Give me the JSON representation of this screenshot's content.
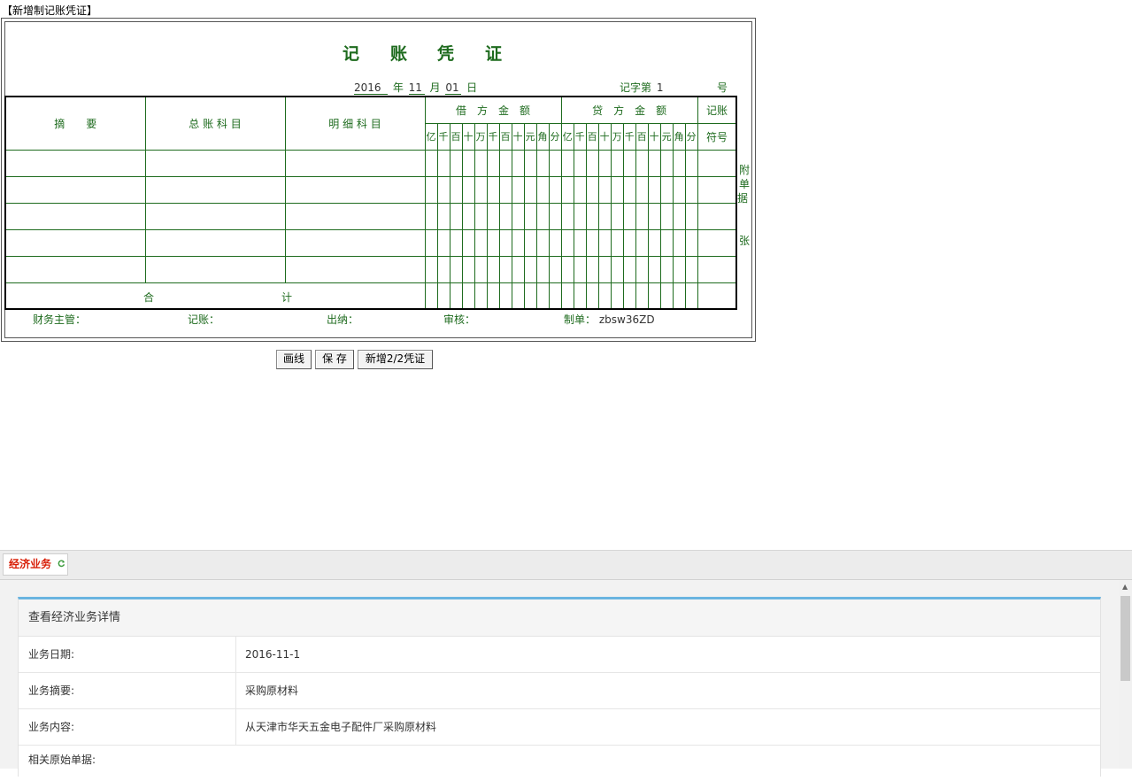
{
  "page_heading": "【新增制记账凭证】",
  "voucher": {
    "title_chars": [
      "记",
      "账",
      "凭",
      "证"
    ],
    "date": {
      "year": "2016",
      "year_unit": "年",
      "month": "11",
      "month_unit": "月",
      "day": "01",
      "day_unit": "日"
    },
    "number": {
      "prefix": "记字第",
      "value": "1",
      "suffix": "号"
    },
    "headers": {
      "summary": "摘　　要",
      "general_account": "总 账 科 目",
      "detail_account": "明 细 科 目",
      "debit": "借　方　金　额",
      "credit": "贷　方　金　额",
      "mark_top": "记账",
      "mark_bottom": "符号",
      "digits": [
        "亿",
        "千",
        "百",
        "十",
        "万",
        "千",
        "百",
        "十",
        "元",
        "角",
        "分"
      ]
    },
    "total_label_left": "合",
    "total_label_right": "计",
    "attachment": {
      "line1": "附",
      "line2": "单",
      "line3": "据",
      "unit": "张"
    },
    "signatures": {
      "supervisor_label": "财务主管：",
      "bookkeeper_label": "记账：",
      "cashier_label": "出纳：",
      "auditor_label": "审核：",
      "preparer_label": "制单：",
      "preparer_value": "zbsw36ZD"
    }
  },
  "buttons": {
    "draw_line": "画线",
    "save": "保 存",
    "new_voucher": "新增2/2凭证"
  },
  "bottom_panel": {
    "tab_label": "经济业务",
    "card_title": "查看经济业务详情",
    "rows": [
      {
        "label": "业务日期:",
        "value": "2016-11-1"
      },
      {
        "label": "业务摘要:",
        "value": "采购原材料"
      },
      {
        "label": "业务内容:",
        "value": "从天津市华天五金电子配件厂采购原材料"
      }
    ],
    "cut_row_label": "相关原始单据:"
  },
  "colors": {
    "ledger_green": "#1e6b1e",
    "tab_red": "#d81e06",
    "card_accent": "#6ab4e0"
  }
}
